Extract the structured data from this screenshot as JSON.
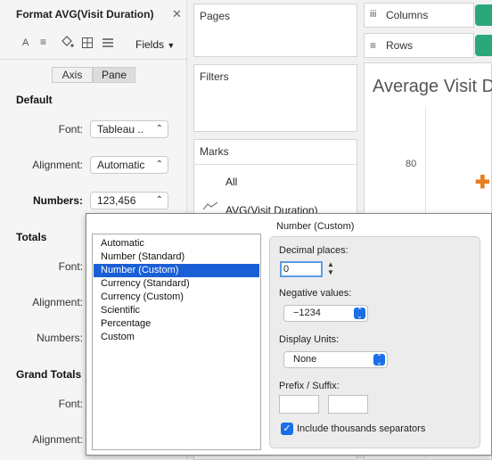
{
  "format_pane": {
    "title": "Format AVG(Visit Duration)",
    "fields_label": "Fields",
    "tabs": [
      "Axis",
      "Pane"
    ],
    "sections": {
      "default": "Default",
      "totals": "Totals",
      "grand_totals": "Grand Totals"
    },
    "rows": {
      "font_label": "Font:",
      "font_value": "Tableau ..",
      "alignment_label": "Alignment:",
      "alignment_value": "Automatic",
      "numbers_label": "Numbers:",
      "numbers_value": "123,456"
    }
  },
  "shelves": {
    "pages": "Pages",
    "filters": "Filters",
    "marks": "Marks",
    "marks_all": "All",
    "marks_field": "AVG(Visit Duration)",
    "columns": "Columns",
    "rows": "Rows"
  },
  "view": {
    "title": "Average Visit D",
    "tick": "80"
  },
  "popup": {
    "formats": [
      "Automatic",
      "Number (Standard)",
      "Number (Custom)",
      "Currency (Standard)",
      "Currency (Custom)",
      "Scientific",
      "Percentage",
      "Custom"
    ],
    "selected_index": 2,
    "custom_title": "Number (Custom)",
    "decimal_label": "Decimal places:",
    "decimal_value": "0",
    "negative_label": "Negative values:",
    "negative_value": "−1234",
    "display_units_label": "Display Units:",
    "display_units_value": "None",
    "prefix_suffix_label": "Prefix / Suffix:",
    "thousands_label": "Include thousands separators",
    "thousands_checked": true
  },
  "colors": {
    "accent": "#1a5fd6",
    "pill_green": "#2aa87a",
    "mark_orange": "#e67e22",
    "mark_blue": "#2f7fc1"
  }
}
